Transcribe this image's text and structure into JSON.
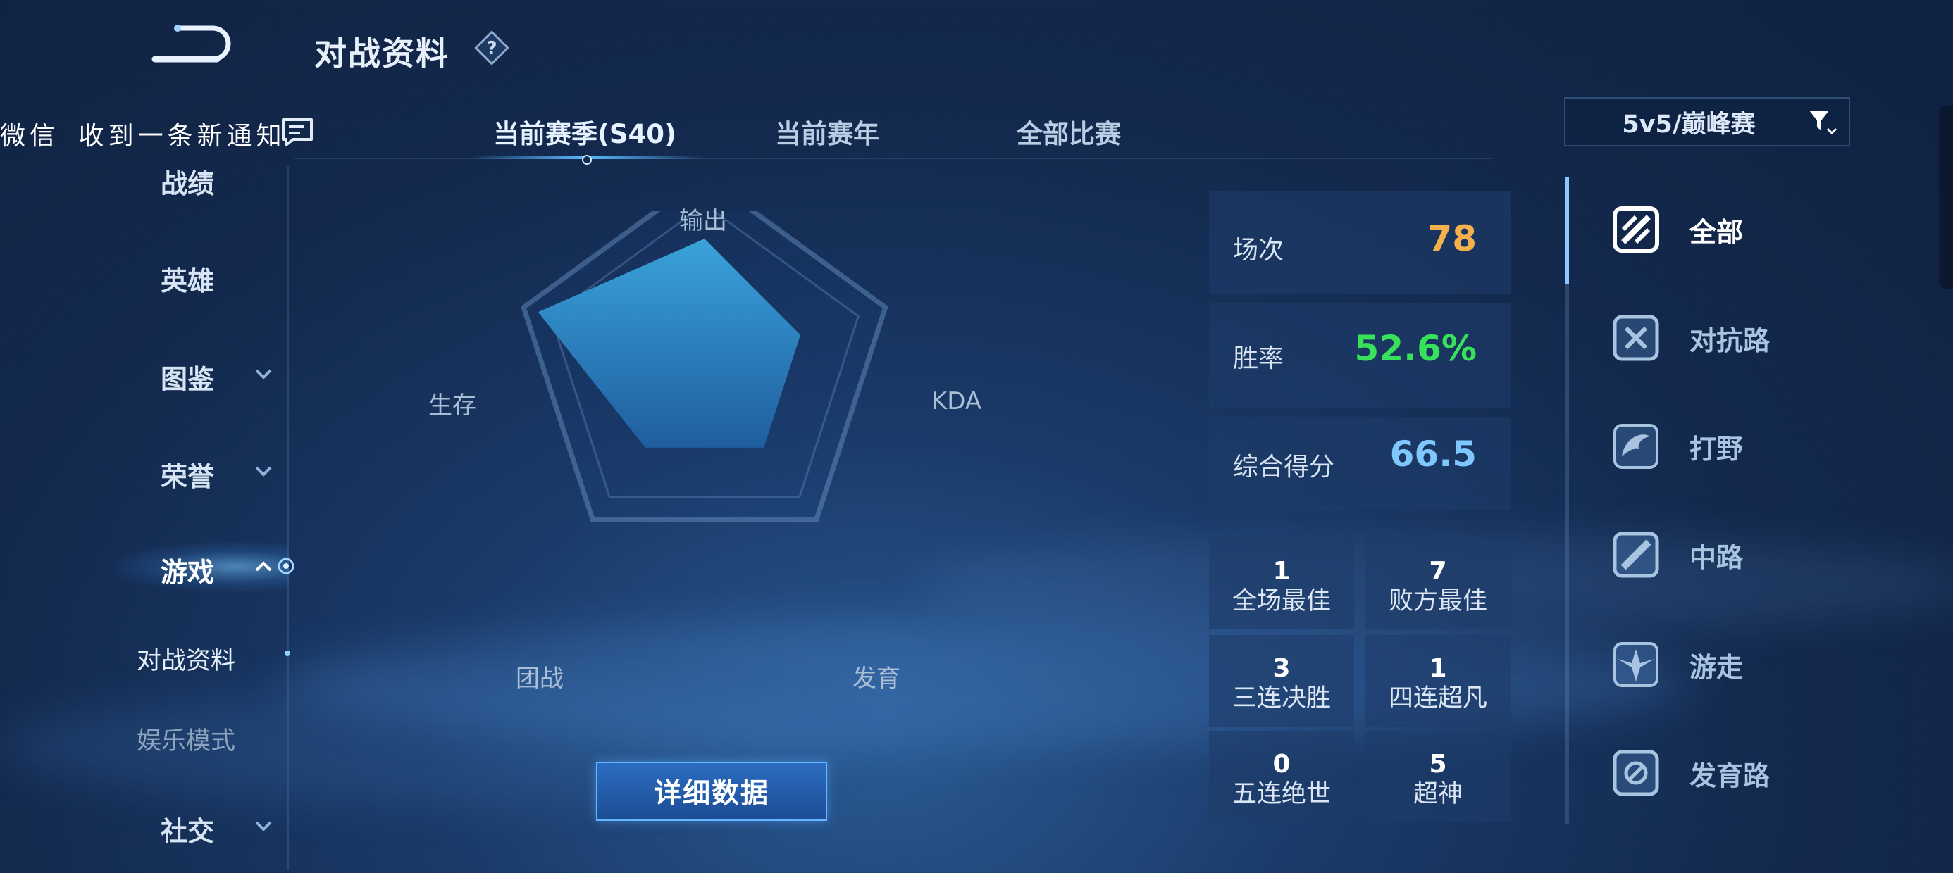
{
  "header": {
    "title": "对战资料"
  },
  "notification": {
    "text": "微信 收到一条新通知"
  },
  "tabs": [
    {
      "label": "当前赛季(S40)",
      "active": true
    },
    {
      "label": "当前赛年",
      "active": false
    },
    {
      "label": "全部比赛",
      "active": false
    }
  ],
  "mode_select": {
    "value": "5v5/巅峰赛"
  },
  "sidebar": {
    "items": [
      {
        "label": "战绩"
      },
      {
        "label": "英雄"
      },
      {
        "label": "图鉴"
      },
      {
        "label": "荣誉"
      },
      {
        "label": "游戏"
      },
      {
        "label": "社交"
      }
    ],
    "subitems": [
      {
        "label": "对战资料",
        "active": true
      },
      {
        "label": "娱乐模式",
        "active": false
      }
    ]
  },
  "radar": {
    "axes": [
      "输出",
      "KDA",
      "发育",
      "团战",
      "生存"
    ],
    "values": [
      0.67,
      0.53,
      0.53,
      0.53,
      0.92
    ]
  },
  "detail_button": {
    "label": "详细数据"
  },
  "stats": {
    "matches": {
      "label": "场次",
      "value": "78",
      "color": "#f4b04c"
    },
    "win_rate": {
      "label": "胜率",
      "value": "52.6%",
      "color": "#37e25a"
    },
    "score": {
      "label": "综合得分",
      "value": "66.5",
      "color": "#7fc8ff"
    }
  },
  "achievements": [
    {
      "count": "1",
      "label": "全场最佳"
    },
    {
      "count": "7",
      "label": "败方最佳"
    },
    {
      "count": "3",
      "label": "三连决胜"
    },
    {
      "count": "1",
      "label": "四连超凡"
    },
    {
      "count": "0",
      "label": "五连绝世"
    },
    {
      "count": "5",
      "label": "超神"
    }
  ],
  "roles": [
    {
      "label": "全部",
      "icon": "all-roles-icon",
      "active": true
    },
    {
      "label": "对抗路",
      "icon": "clash-lane-icon",
      "active": false
    },
    {
      "label": "打野",
      "icon": "jungle-icon",
      "active": false
    },
    {
      "label": "中路",
      "icon": "mid-lane-icon",
      "active": false
    },
    {
      "label": "游走",
      "icon": "roam-icon",
      "active": false
    },
    {
      "label": "发育路",
      "icon": "farm-lane-icon",
      "active": false
    }
  ]
}
